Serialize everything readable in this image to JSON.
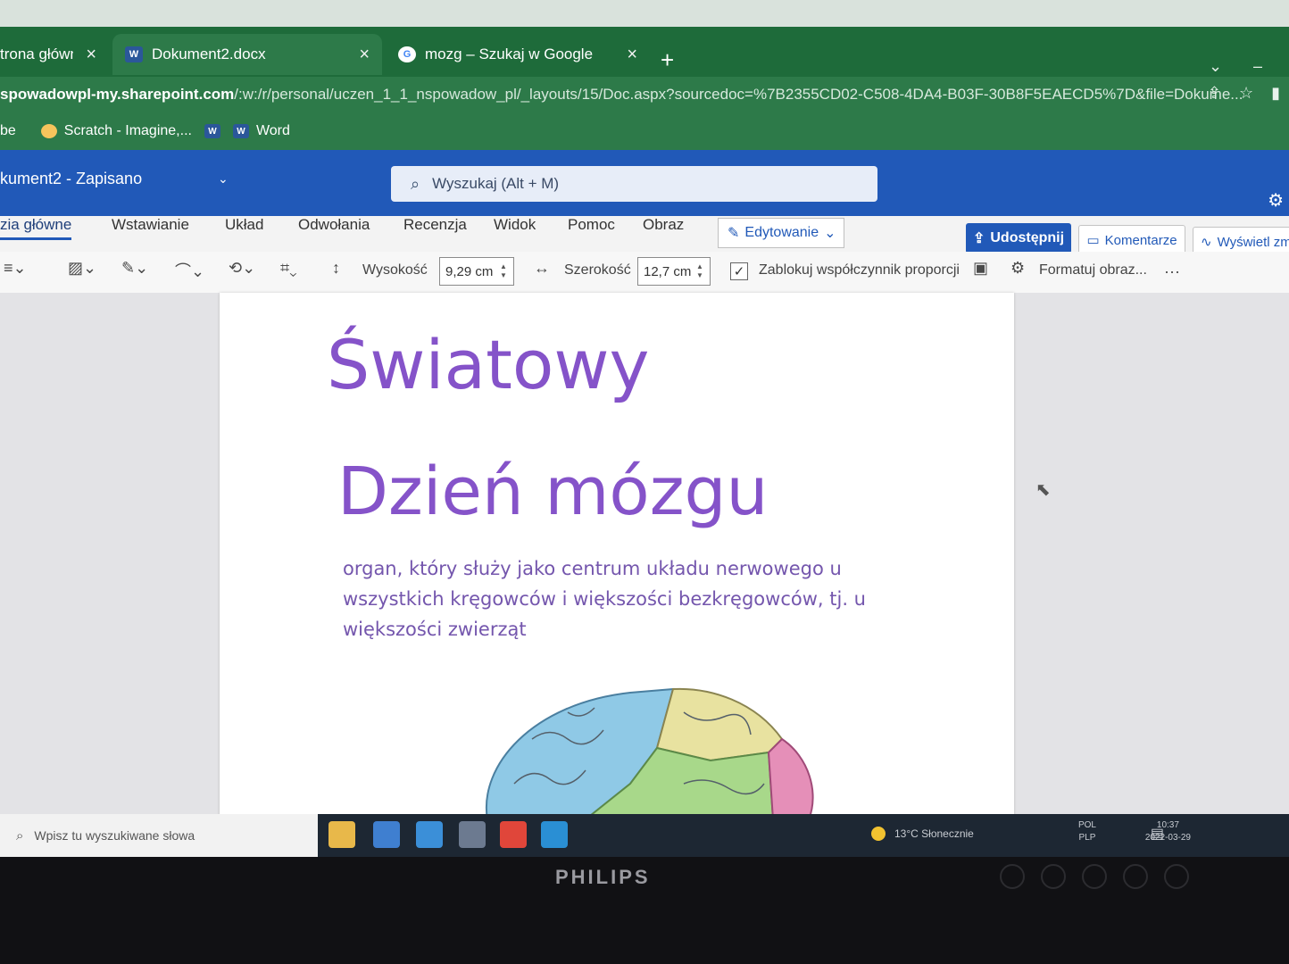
{
  "browser": {
    "tabs": [
      {
        "label": "trona główn",
        "close": "×"
      },
      {
        "label": "Dokument2.docx",
        "close": "×",
        "favicon": "W"
      },
      {
        "label": "mozg – Szukaj w Google",
        "close": "×",
        "favicon": "G"
      }
    ],
    "new_tab": "+",
    "url_host": "spowadowpl-my.sharepoint.com",
    "url_path": "/:w:/r/personal/uczen_1_1_nspowadow_pl/_layouts/15/Doc.aspx?sourcedoc=%7B2355CD02-C508-4DA4-B03F-30B8F5EAECD5%7D&file=Dokume...",
    "bookmarks": [
      {
        "label": "be"
      },
      {
        "label": "Scratch - Imagine,..."
      },
      {
        "label": ""
      },
      {
        "label": "Word"
      }
    ]
  },
  "word": {
    "doc_title": "kument2  -  Zapisano",
    "search_placeholder": "Wyszukaj (Alt + M)",
    "ribbon_tabs": [
      "zia główne",
      "Wstawianie",
      "Układ",
      "Odwołania",
      "Recenzja",
      "Widok",
      "Pomoc",
      "Obraz"
    ],
    "editing_mode": "Edytowanie",
    "share": "Udostępnij",
    "comments": "Komentarze",
    "view": "Wyświetl zm",
    "toolbar": {
      "height_label": "Wysokość",
      "height_value": "9,29 cm",
      "width_label": "Szerokość",
      "width_value": "12,7 cm",
      "lock_ratio": "Zablokuj współczynnik proporcji",
      "format_picture": "Formatuj obraz...",
      "more": "···"
    }
  },
  "document": {
    "title_line1": "Światowy",
    "title_line2": "Dzień mózgu",
    "description": "organ, który służy jako centrum układu nerwowego u wszystkich kręgowców i większości bezkręgowców, tj. u większości zwierząt"
  },
  "taskbar": {
    "search_placeholder": "Wpisz tu wyszukiwane słowa",
    "weather": "13°C  Słonecznie",
    "lang_line1": "POL",
    "lang_line2": "PLP",
    "time": "10:37",
    "date": "2022-03-29"
  },
  "monitor": {
    "brand": "PHILIPS"
  },
  "colors": {
    "word_blue": "#2159b8",
    "chrome_green": "#2d7a49",
    "title_purple": "#8553c9"
  }
}
